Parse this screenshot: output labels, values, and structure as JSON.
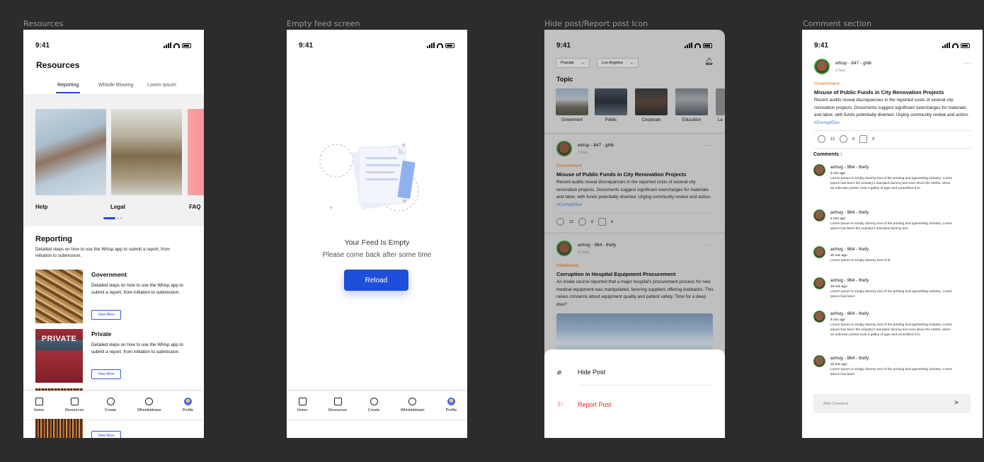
{
  "frames": {
    "resources": "Resources",
    "empty": "Empty feed screen",
    "hide": "Hide post/Report post Icon",
    "comments": "Comment section"
  },
  "status_time": "9:41",
  "nav": [
    "Home",
    "Resources",
    "Create",
    "Whistleblower",
    "Profile"
  ],
  "resources": {
    "title": "Resources",
    "tabs": [
      "Reporting",
      "Whistle Blowing",
      "Lorem Ipsum"
    ],
    "cards": [
      "Help",
      "Legal",
      "FAQ"
    ],
    "section_title": "Reporting",
    "section_desc": "Detailed steps on how to use the Whisp app to submit a report, from initiation to submission.",
    "items": [
      {
        "title": "Government",
        "desc": "Detailed steps on how to use the Whisp app to submit a report, from initiation to submission.",
        "button": "View More"
      },
      {
        "title": "Private",
        "desc": "Detailed steps on how to use the Whisp app to submit a report, from initiation to submission.",
        "button": "View More"
      },
      {
        "title": "",
        "desc": "submission.",
        "button": "View More"
      }
    ],
    "private_sign": "PRIVATE"
  },
  "empty": {
    "title": "Your Feed Is Empty",
    "subtitle": "Please come back after some time",
    "reload": "Reload"
  },
  "feed": {
    "filter1": "Popular",
    "filter2": "Los Angeles",
    "topic_title": "Topic",
    "topics": [
      "Goverment",
      "Public",
      "Corporate",
      "Education",
      "La"
    ],
    "post1": {
      "user": "whisp - 847 - ghtk",
      "time": "1 hour",
      "category": "Government",
      "title": "Misuse of Public Funds in City Renovation Projects",
      "body": "Recent audits reveal discrepancies in the reported costs of several city renovation projects. Documents suggest significant overcharges for materials and labor, with funds potentially diverted. Urging community review and action.",
      "tag": "#CorruptGov",
      "up": "12",
      "down": "6",
      "comments": "6"
    },
    "post2": {
      "user": "anhvg - 964 - thefy",
      "time": "11 hour",
      "category": "Healthcare",
      "title": "Corruption in Hospital Equipment Procurement",
      "body": "An inside source reported that a major hospital's procurement process for new medical equipment was manipulated, favoring suppliers offering kickbacks. This raises concerns about equipment quality and patient safety. Time for a deep dive?"
    },
    "sheet": {
      "hide": "Hide Post",
      "report": "Report Post"
    }
  },
  "comments": {
    "heading": "Comments :",
    "add_placeholder": "Add Comment",
    "list": [
      {
        "user": "anhvg - 964 - thefy",
        "time": "5 min ago",
        "text": "Lorem Ipsum is simply dummy text of the printing and typesetting industry. Lorem Ipsum has been the industry's standard dummy text ever since the 1500s, when an unknown printer took a galley of type and scrambled it to"
      },
      {
        "user": "anhvg - 964 - thefy",
        "time": "5 min ago",
        "text": "Lorem Ipsum is simply dummy text of the printing and typesetting industry. Lorem Ipsum has been the industry's standard dummy text"
      },
      {
        "user": "anhvg - 964 - thefy",
        "time": "20 min ago",
        "text": "Lorem Ipsum is simply dummy text of th"
      },
      {
        "user": "anhvg - 964 - thefy",
        "time": "10 min ago",
        "text": "Lorem Ipsum is simply dummy text of the printing and typesetting industry. Lorem Ipsum has been"
      },
      {
        "user": "anhvg - 964 - thefy",
        "time": "5 min ago",
        "text": "Lorem Ipsum is simply dummy text of the printing and typesetting industry. Lorem Ipsum has been the industry's standard dummy text ever since the 1500s, when an unknown printer took a galley of type and scrambled it to"
      },
      {
        "user": "anhvg - 964 - thefy",
        "time": "10 min ago",
        "text": "Lorem Ipsum is simply dummy text of the printing and typesetting industry. Lorem Ipsum has been"
      }
    ]
  },
  "colors": {
    "accent": "#1d4fd8",
    "government": "#e0701d",
    "report": "#e02424",
    "tag": "#3a7be0"
  }
}
